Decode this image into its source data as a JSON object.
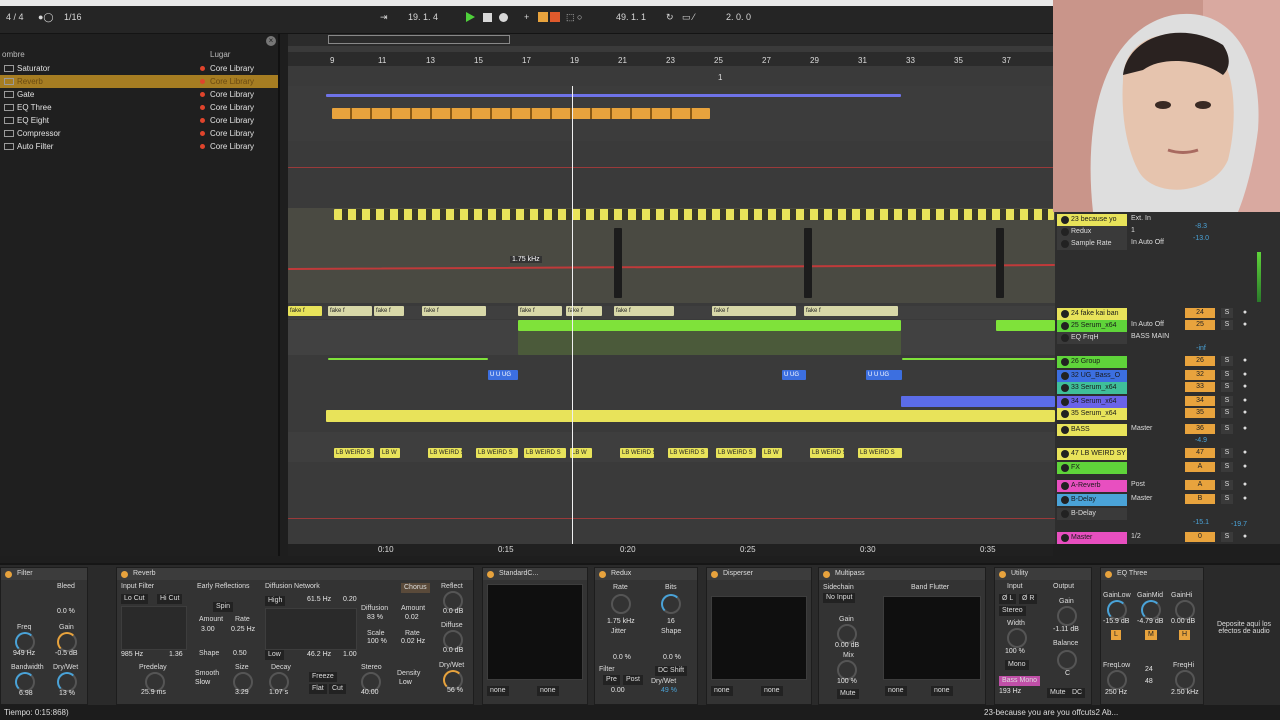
{
  "transport": {
    "time_sig": "4 / 4",
    "quantize": "1/16",
    "position": "19.  1.  4",
    "loop_start": "49.  1.  1",
    "loop_length": "2.  0.  0"
  },
  "browser": {
    "col_name": "ombre",
    "col_place": "Lugar",
    "items": [
      {
        "name": "Saturator",
        "place": "Core Library"
      },
      {
        "name": "Reverb",
        "place": "Core Library"
      },
      {
        "name": "Gate",
        "place": "Core Library"
      },
      {
        "name": "EQ Three",
        "place": "Core Library"
      },
      {
        "name": "EQ Eight",
        "place": "Core Library"
      },
      {
        "name": "Compressor",
        "place": "Core Library"
      },
      {
        "name": "Auto Filter",
        "place": "Core Library"
      }
    ],
    "close_icon": "×"
  },
  "ruler": [
    "9",
    "11",
    "13",
    "15",
    "17",
    "19",
    "21",
    "23",
    "25",
    "27",
    "29",
    "31",
    "33",
    "35",
    "37"
  ],
  "marker": "1",
  "automation_tooltip": "1.75 kHz",
  "clip_labels": {
    "fake": "fake f",
    "ug1": "U U UG",
    "ug2": "U UG",
    "ug3": "U U UG",
    "weird": "LB WEIRD S",
    "weird_short": "LB W"
  },
  "timeline": [
    "0:10",
    "0:15",
    "0:20",
    "0:25",
    "0:30",
    "0:35"
  ],
  "mixer": {
    "tracks": [
      {
        "name": "23 because yo",
        "color": "#e8e35a",
        "num": "",
        "sub": "Ext. In"
      },
      {
        "name": "Redux",
        "color": "#3a3a3a",
        "num": "",
        "sub": "1"
      },
      {
        "name": "Sample Rate",
        "color": "#3a3a3a",
        "num": "",
        "sub": "In  Auto  Off"
      },
      {
        "name": "24 fake kai ban",
        "color": "#e8e35a",
        "num": "24",
        "sub": ""
      },
      {
        "name": "25 Serum_x64",
        "color": "#5fd43a",
        "num": "25",
        "sub": "In  Auto  Off"
      },
      {
        "name": "EQ FrqH",
        "color": "#3a3a3a",
        "num": "",
        "sub": "BASS MAIN"
      },
      {
        "name": "26 Group",
        "color": "#5fd43a",
        "num": "26",
        "sub": ""
      },
      {
        "name": "32 UG_Bass_O",
        "color": "#3c6fe0",
        "num": "32",
        "sub": ""
      },
      {
        "name": "33 Serum_x64",
        "color": "#3fbf9a",
        "num": "33",
        "sub": ""
      },
      {
        "name": "34 Serum_x64",
        "color": "#6a63e8",
        "num": "34",
        "sub": ""
      },
      {
        "name": "35 Serum_x64",
        "color": "#e8e35a",
        "num": "35",
        "sub": ""
      },
      {
        "name": "BASS",
        "color": "#e8e35a",
        "num": "36",
        "sub": "Master"
      },
      {
        "name": "47 LB WEIRD SY",
        "color": "#e8e35a",
        "num": "47",
        "sub": ""
      },
      {
        "name": "FX",
        "color": "#5fd43a",
        "num": "A",
        "sub": ""
      },
      {
        "name": "A-Reverb",
        "color": "#e84fc0",
        "num": "A",
        "sub": "Post"
      },
      {
        "name": "B-Delay",
        "color": "#4aa3d8",
        "num": "B",
        "sub": "Master"
      },
      {
        "name": "B-Delay",
        "color": "#3a3a3a",
        "num": "",
        "sub": ""
      },
      {
        "name": "Master",
        "color": "#e84fc0",
        "num": "0",
        "sub": "1/2"
      }
    ],
    "vol_1": "-8.3",
    "vol_2": "-13.0",
    "vol_3": "-inf",
    "vol_4": "-4.9",
    "vol_5": "-15.1",
    "vol_6": "-19.7"
  },
  "devices": {
    "filter": {
      "title": "Filter",
      "bleed": "Bleed",
      "bleed_val": "0.0 %",
      "freq": "Freq",
      "freq_val": "949 Hz",
      "gain": "Gain",
      "gain_val": "-0.5 dB",
      "bw": "Bandwidth",
      "bw_val": "6.98",
      "dw": "Dry/Wet",
      "dw_val": "13 %"
    },
    "reverb": {
      "title": "Reverb",
      "input_filter": "Input Filter",
      "lo_cut": "Lo Cut",
      "hi_cut": "Hi Cut",
      "freq_lo": "985 Hz",
      "freq_hi": "1.36",
      "early": "Early Reflections",
      "spin": "Spin",
      "amount": "Amount",
      "rate": "Rate",
      "amount_val": "3.00",
      "rate_val": "0.25 Hz",
      "shape": "Shape",
      "shape_val": "0.50",
      "diffusion_net": "Diffusion Network",
      "chorus": "Chorus",
      "high": "High",
      "high_val": "61.5 Hz",
      "low": "Low",
      "low_val": "46.2 Hz",
      "hv2": "0.20",
      "lv2": "1.00",
      "diffusion": "Diffusion",
      "diff_val": "83 %",
      "scale": "Scale",
      "scale_val": "100 %",
      "amt2": "Amount",
      "amt2_val": "0.02",
      "rate2": "Rate",
      "rate2_val": "0.02 Hz",
      "reflect": "Reflect",
      "reflect_val": "0.0 dB",
      "diffuse": "Diffuse",
      "diffuse_val": "0.0 dB",
      "predelay": "Predelay",
      "predelay_val": "25.9 ms",
      "smooth": "Smooth",
      "smooth_val": "Slow",
      "size": "Size",
      "size_val": "3.29",
      "decay": "Decay",
      "decay_val": "1.07 s",
      "freeze": "Freeze",
      "flat": "Flat",
      "cut": "Cut",
      "stereo": "Stereo",
      "stereo_val": "40.00",
      "density": "Density",
      "density_val": "Low",
      "dw": "Dry/Wet",
      "dw_val": "56 %"
    },
    "standard": {
      "title": "StandardC...",
      "none1": "none",
      "none2": "none"
    },
    "redux": {
      "title": "Redux",
      "rate": "Rate",
      "bits": "Bits",
      "rate_val": "1.75 kHz",
      "bits_val": "16",
      "jitter": "Jitter",
      "jitter_val": "0.0 %",
      "shape": "Shape",
      "shape_val": "0.0 %",
      "filter": "Filter",
      "pre": "Pre",
      "post": "Post",
      "filter_val": "0.00",
      "dc": "DC Shift",
      "dw": "Dry/Wet",
      "dw_val": "49 %"
    },
    "disperser": {
      "title": "Disperser",
      "none1": "none",
      "none2": "none"
    },
    "multipass": {
      "title": "Multipass",
      "sidechain": "Sidechain",
      "no_input": "No Input",
      "gain": "Gain",
      "gain_val": "0.00 dB",
      "mix": "Mix",
      "mix_val": "100 %",
      "mute": "Mute",
      "band": "Band Flutter",
      "none1": "none",
      "none2": "none"
    },
    "utility": {
      "title": "Utility",
      "input": "Input",
      "output": "Output",
      "ol": "Ø L",
      "or": "Ø R",
      "stereo": "Stereo",
      "width": "Width",
      "width_val": "100 %",
      "mono": "Mono",
      "gain": "Gain",
      "gain_val": "-1.11 dB",
      "balance": "Balance",
      "bal_val": "C",
      "bass_mono": "Bass Mono",
      "bass_val": "193 Hz",
      "mute": "Mute",
      "dc": "DC"
    },
    "eq3": {
      "title": "EQ Three",
      "gl": "GainLow",
      "gm": "GainMid",
      "gh": "GainHi",
      "gl_val": "-15.9 dB",
      "gm_val": "-4.79 dB",
      "gh_val": "0.00 dB",
      "l": "L",
      "m": "M",
      "h": "H",
      "fl": "FreqLow",
      "fh": "FreqHi",
      "fl_val": "250 Hz",
      "fh_val": "2.50 kHz",
      "num": "24",
      "num2": "48"
    },
    "drop_text": "Deposite aquí los efectos de audio"
  },
  "status": {
    "left": "Tiempo: 0:15:868)",
    "right": "23-because you are you offcuts2 Ab..."
  },
  "colors": {
    "accent": "#e8a33d",
    "play": "#4fd13b",
    "clip_yellow": "#e8e35a",
    "clip_green": "#7fe23a",
    "clip_orange": "#e8a33d",
    "clip_blue": "#3c6fe0"
  }
}
